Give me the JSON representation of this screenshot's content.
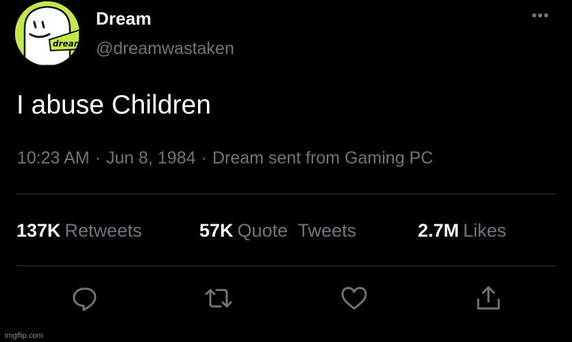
{
  "tweet": {
    "avatar_text": "dream",
    "display_name": "Dream",
    "handle": "@dreamwastaken",
    "more_label": "•••",
    "text": "I abuse Children",
    "time": "10:23 AM",
    "date": "Jun 8, 1984",
    "source": "Dream sent from Gaming PC",
    "separator": "·"
  },
  "stats": {
    "retweets": {
      "count": "137K",
      "label": "Retweets"
    },
    "quotes": {
      "count": "57K",
      "label": "Quote  Tweets"
    },
    "likes": {
      "count": "2.7M",
      "label": "Likes"
    }
  },
  "actions": [
    {
      "name": "reply",
      "icon": "reply-icon"
    },
    {
      "name": "retweet",
      "icon": "retweet-icon"
    },
    {
      "name": "like",
      "icon": "heart-icon"
    },
    {
      "name": "share",
      "icon": "share-icon"
    }
  ],
  "watermark": "imgflip.com",
  "colors": {
    "background": "#000000",
    "text": "#ffffff",
    "secondary_text": "#6e767d",
    "divider": "#2f3336",
    "avatar_bg": "#c4e74a"
  }
}
